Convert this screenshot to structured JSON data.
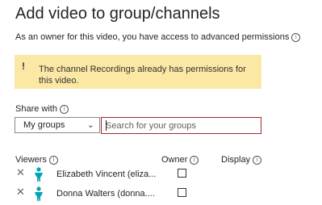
{
  "header": {
    "title": "Add video to group/channels"
  },
  "description": {
    "text": "As an owner for this video, you have access to advanced permissions"
  },
  "warning": {
    "icon": "!",
    "message": "The channel Recordings already has permissions for this video."
  },
  "share": {
    "label": "Share with",
    "dropdown_value": "My groups",
    "search_placeholder": "Search for your groups"
  },
  "table": {
    "columns": [
      "Viewers",
      "Owner",
      "Display"
    ],
    "rows": [
      {
        "name": "Elizabeth Vincent (eliza...",
        "owner_checked": false
      },
      {
        "name": "Donna Walters (donna....",
        "owner_checked": false
      }
    ]
  },
  "colors": {
    "accent": "#00a4b4",
    "warning_bg": "#fbe8a4",
    "search_border": "#a4262c"
  }
}
